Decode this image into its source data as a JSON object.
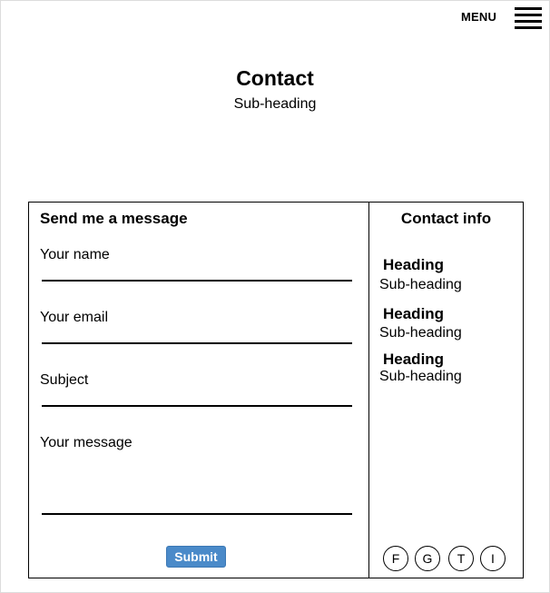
{
  "header": {
    "menu_label": "MENU",
    "menu_icon": "hamburger-icon"
  },
  "page": {
    "title": "Contact",
    "subtitle": "Sub-heading"
  },
  "message_form": {
    "title": "Send me a message",
    "fields": [
      {
        "label": "Your name"
      },
      {
        "label": "Your email"
      },
      {
        "label": "Subject"
      },
      {
        "label": "Your message"
      }
    ],
    "submit_label": "Submit",
    "submit_color": "#4a8ac9"
  },
  "contact_info": {
    "title": "Contact info",
    "items": [
      {
        "heading": "Heading",
        "subheading": "Sub-heading"
      },
      {
        "heading": "Heading",
        "subheading": "Sub-heading"
      },
      {
        "heading": "Heading",
        "subheading": "Sub-heading"
      }
    ],
    "social": [
      {
        "label": "F",
        "icon": "facebook-icon"
      },
      {
        "label": "G",
        "icon": "google-icon"
      },
      {
        "label": "T",
        "icon": "twitter-icon"
      },
      {
        "label": "I",
        "icon": "instagram-icon"
      }
    ]
  }
}
